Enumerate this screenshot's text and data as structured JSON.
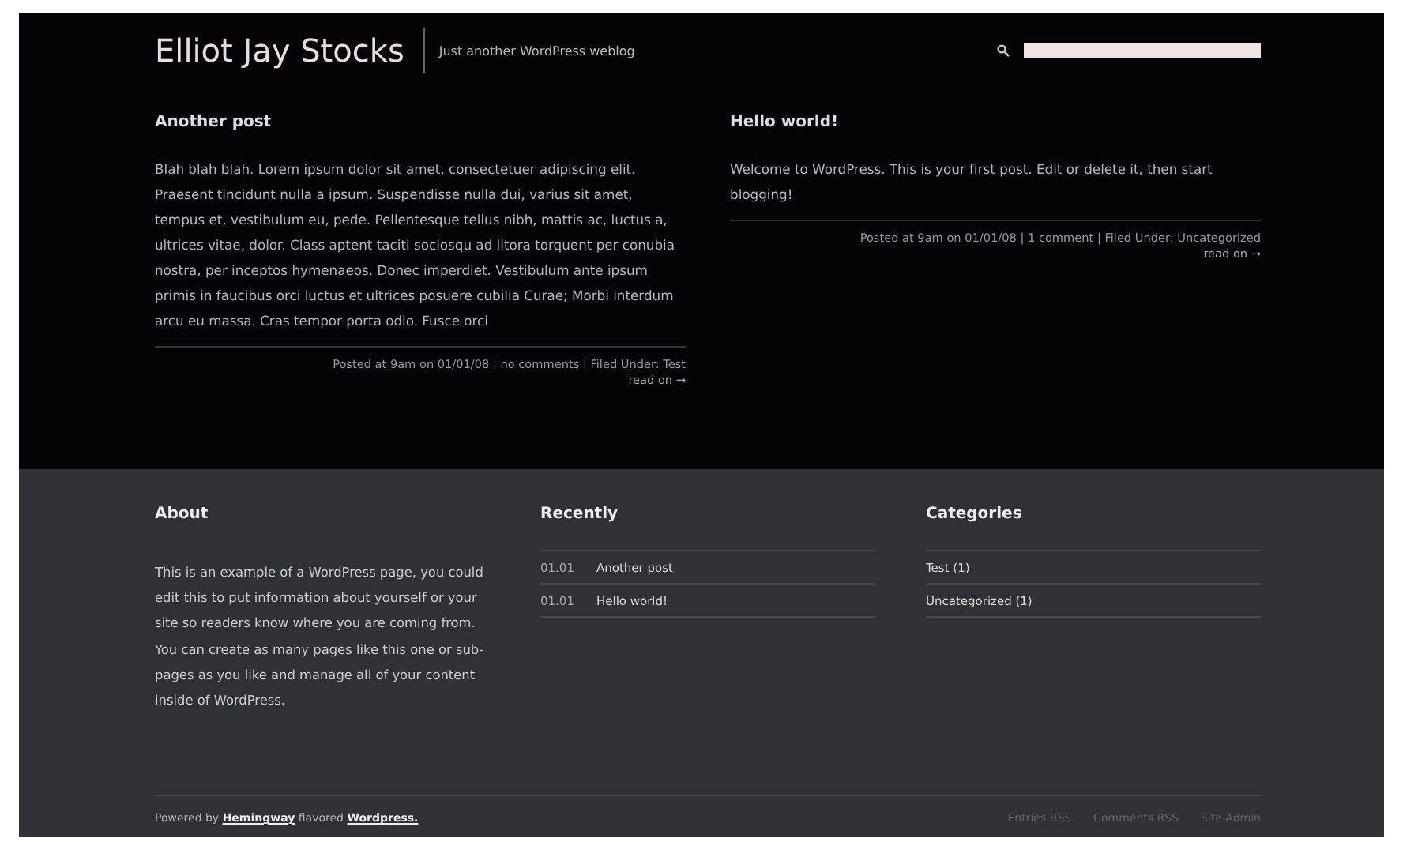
{
  "header": {
    "site_title": "Elliot Jay Stocks",
    "tagline": "Just another WordPress weblog"
  },
  "posts": [
    {
      "title": "Another post",
      "body": "Blah blah blah. Lorem ipsum dolor sit amet, consectetuer adipiscing elit. Praesent tincidunt nulla a ipsum. Suspendisse nulla dui, varius sit amet, tempus et, vestibulum eu, pede. Pellentesque tellus nibh, mattis ac, luctus a, ultrices vitae, dolor. Class aptent taciti sociosqu ad litora torquent per conubia nostra, per inceptos hymenaeos. Donec imperdiet. Vestibulum ante ipsum primis in faucibus orci luctus et ultrices posuere cubilia Curae; Morbi interdum arcu eu massa. Cras tempor porta odio. Fusce orci",
      "meta": "Posted at 9am on 01/01/08 | no comments | Filed Under: Test",
      "read_on": "read on →"
    },
    {
      "title": "Hello world!",
      "body": "Welcome to WordPress. This is your first post. Edit or delete it, then start blogging!",
      "meta": "Posted at 9am on 01/01/08 | 1 comment | Filed Under: Uncategorized",
      "read_on": "read on →"
    }
  ],
  "footer": {
    "about": {
      "heading": "About",
      "text": "This is an example of a WordPress page, you could edit this to put information about yourself or your site so readers know where you are coming from. You can create as many pages like this one or sub-pages as you like and manage all of your content inside of WordPress."
    },
    "recently": {
      "heading": "Recently",
      "items": [
        {
          "date": "01.01",
          "title": "Another post"
        },
        {
          "date": "01.01",
          "title": "Hello world!"
        }
      ]
    },
    "categories": {
      "heading": "Categories",
      "items": [
        "Test (1)",
        "Uncategorized (1)"
      ]
    }
  },
  "credits": [
    {
      "kind": "text",
      "text": "Powered by"
    },
    {
      "kind": "link",
      "text": "Hemingway"
    },
    {
      "kind": "text",
      "text": "flavored"
    },
    {
      "kind": "link",
      "text": "Wordpress."
    }
  ],
  "bottom_links": [
    "Entries RSS",
    "Comments RSS",
    "Site Admin"
  ]
}
